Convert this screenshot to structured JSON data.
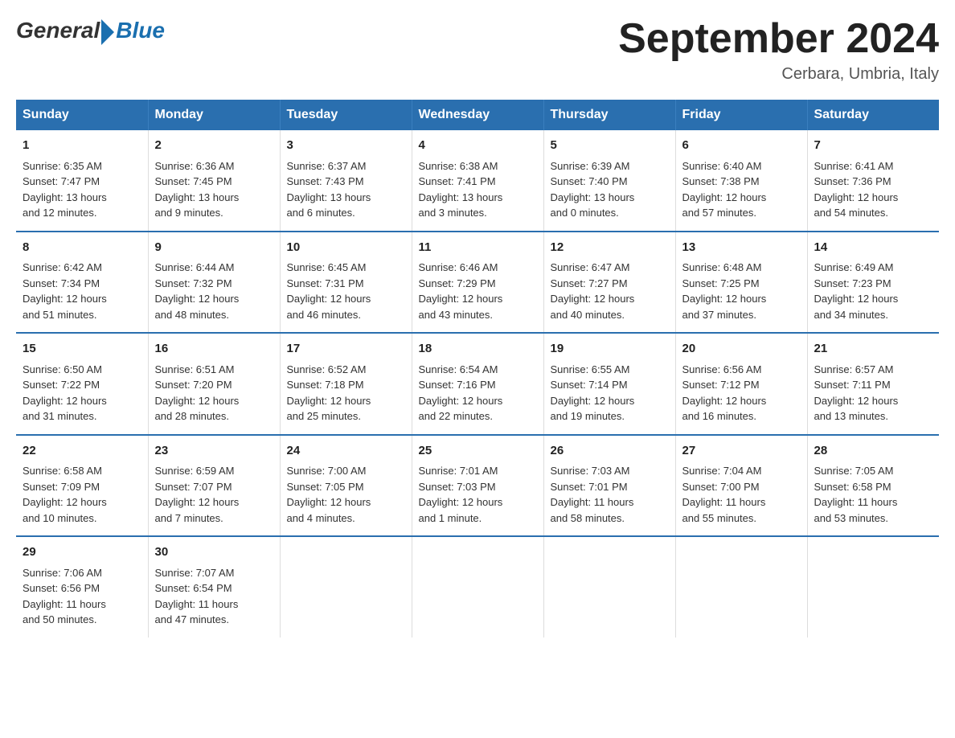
{
  "header": {
    "logo_general": "General",
    "logo_blue": "Blue",
    "month_title": "September 2024",
    "location": "Cerbara, Umbria, Italy"
  },
  "days_of_week": [
    "Sunday",
    "Monday",
    "Tuesday",
    "Wednesday",
    "Thursday",
    "Friday",
    "Saturday"
  ],
  "weeks": [
    [
      {
        "num": "1",
        "info": "Sunrise: 6:35 AM\nSunset: 7:47 PM\nDaylight: 13 hours\nand 12 minutes."
      },
      {
        "num": "2",
        "info": "Sunrise: 6:36 AM\nSunset: 7:45 PM\nDaylight: 13 hours\nand 9 minutes."
      },
      {
        "num": "3",
        "info": "Sunrise: 6:37 AM\nSunset: 7:43 PM\nDaylight: 13 hours\nand 6 minutes."
      },
      {
        "num": "4",
        "info": "Sunrise: 6:38 AM\nSunset: 7:41 PM\nDaylight: 13 hours\nand 3 minutes."
      },
      {
        "num": "5",
        "info": "Sunrise: 6:39 AM\nSunset: 7:40 PM\nDaylight: 13 hours\nand 0 minutes."
      },
      {
        "num": "6",
        "info": "Sunrise: 6:40 AM\nSunset: 7:38 PM\nDaylight: 12 hours\nand 57 minutes."
      },
      {
        "num": "7",
        "info": "Sunrise: 6:41 AM\nSunset: 7:36 PM\nDaylight: 12 hours\nand 54 minutes."
      }
    ],
    [
      {
        "num": "8",
        "info": "Sunrise: 6:42 AM\nSunset: 7:34 PM\nDaylight: 12 hours\nand 51 minutes."
      },
      {
        "num": "9",
        "info": "Sunrise: 6:44 AM\nSunset: 7:32 PM\nDaylight: 12 hours\nand 48 minutes."
      },
      {
        "num": "10",
        "info": "Sunrise: 6:45 AM\nSunset: 7:31 PM\nDaylight: 12 hours\nand 46 minutes."
      },
      {
        "num": "11",
        "info": "Sunrise: 6:46 AM\nSunset: 7:29 PM\nDaylight: 12 hours\nand 43 minutes."
      },
      {
        "num": "12",
        "info": "Sunrise: 6:47 AM\nSunset: 7:27 PM\nDaylight: 12 hours\nand 40 minutes."
      },
      {
        "num": "13",
        "info": "Sunrise: 6:48 AM\nSunset: 7:25 PM\nDaylight: 12 hours\nand 37 minutes."
      },
      {
        "num": "14",
        "info": "Sunrise: 6:49 AM\nSunset: 7:23 PM\nDaylight: 12 hours\nand 34 minutes."
      }
    ],
    [
      {
        "num": "15",
        "info": "Sunrise: 6:50 AM\nSunset: 7:22 PM\nDaylight: 12 hours\nand 31 minutes."
      },
      {
        "num": "16",
        "info": "Sunrise: 6:51 AM\nSunset: 7:20 PM\nDaylight: 12 hours\nand 28 minutes."
      },
      {
        "num": "17",
        "info": "Sunrise: 6:52 AM\nSunset: 7:18 PM\nDaylight: 12 hours\nand 25 minutes."
      },
      {
        "num": "18",
        "info": "Sunrise: 6:54 AM\nSunset: 7:16 PM\nDaylight: 12 hours\nand 22 minutes."
      },
      {
        "num": "19",
        "info": "Sunrise: 6:55 AM\nSunset: 7:14 PM\nDaylight: 12 hours\nand 19 minutes."
      },
      {
        "num": "20",
        "info": "Sunrise: 6:56 AM\nSunset: 7:12 PM\nDaylight: 12 hours\nand 16 minutes."
      },
      {
        "num": "21",
        "info": "Sunrise: 6:57 AM\nSunset: 7:11 PM\nDaylight: 12 hours\nand 13 minutes."
      }
    ],
    [
      {
        "num": "22",
        "info": "Sunrise: 6:58 AM\nSunset: 7:09 PM\nDaylight: 12 hours\nand 10 minutes."
      },
      {
        "num": "23",
        "info": "Sunrise: 6:59 AM\nSunset: 7:07 PM\nDaylight: 12 hours\nand 7 minutes."
      },
      {
        "num": "24",
        "info": "Sunrise: 7:00 AM\nSunset: 7:05 PM\nDaylight: 12 hours\nand 4 minutes."
      },
      {
        "num": "25",
        "info": "Sunrise: 7:01 AM\nSunset: 7:03 PM\nDaylight: 12 hours\nand 1 minute."
      },
      {
        "num": "26",
        "info": "Sunrise: 7:03 AM\nSunset: 7:01 PM\nDaylight: 11 hours\nand 58 minutes."
      },
      {
        "num": "27",
        "info": "Sunrise: 7:04 AM\nSunset: 7:00 PM\nDaylight: 11 hours\nand 55 minutes."
      },
      {
        "num": "28",
        "info": "Sunrise: 7:05 AM\nSunset: 6:58 PM\nDaylight: 11 hours\nand 53 minutes."
      }
    ],
    [
      {
        "num": "29",
        "info": "Sunrise: 7:06 AM\nSunset: 6:56 PM\nDaylight: 11 hours\nand 50 minutes."
      },
      {
        "num": "30",
        "info": "Sunrise: 7:07 AM\nSunset: 6:54 PM\nDaylight: 11 hours\nand 47 minutes."
      },
      {
        "num": "",
        "info": ""
      },
      {
        "num": "",
        "info": ""
      },
      {
        "num": "",
        "info": ""
      },
      {
        "num": "",
        "info": ""
      },
      {
        "num": "",
        "info": ""
      }
    ]
  ]
}
